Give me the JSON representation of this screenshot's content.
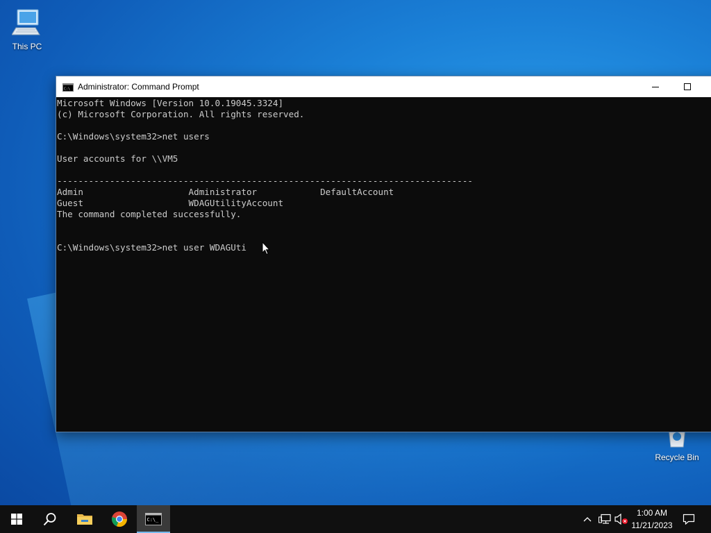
{
  "desktop": {
    "icons": [
      {
        "label": "This PC",
        "icon": "computer-icon"
      },
      {
        "label": "Recycle Bin",
        "icon": "recycle-bin-icon"
      }
    ]
  },
  "window": {
    "title": "Administrator: Command Prompt",
    "icon": "cmd-icon",
    "controls": {
      "minimize": "minimize-icon",
      "maximize": "maximize-icon"
    },
    "console_lines": [
      "Microsoft Windows [Version 10.0.19045.3324]",
      "(c) Microsoft Corporation. All rights reserved.",
      "",
      "C:\\Windows\\system32>net users",
      "",
      "User accounts for \\\\VM5",
      "",
      "-------------------------------------------------------------------------------",
      "Admin                    Administrator            DefaultAccount",
      "Guest                    WDAGUtilityAccount",
      "The command completed successfully.",
      "",
      "",
      "C:\\Windows\\system32>net user WDAGUti"
    ]
  },
  "taskbar": {
    "items": [
      {
        "name": "start",
        "icon": "windows-logo-icon"
      },
      {
        "name": "search",
        "icon": "search-icon"
      },
      {
        "name": "file-explorer",
        "icon": "folder-icon"
      },
      {
        "name": "chrome",
        "icon": "chrome-icon"
      },
      {
        "name": "command-prompt",
        "icon": "cmd-icon",
        "active": true
      }
    ],
    "tray": {
      "icons": [
        "chevron-up-icon",
        "network-icon",
        "volume-muted-icon"
      ],
      "time": "1:00 AM",
      "date": "11/21/2023",
      "notification_icon": "notification-icon"
    }
  }
}
